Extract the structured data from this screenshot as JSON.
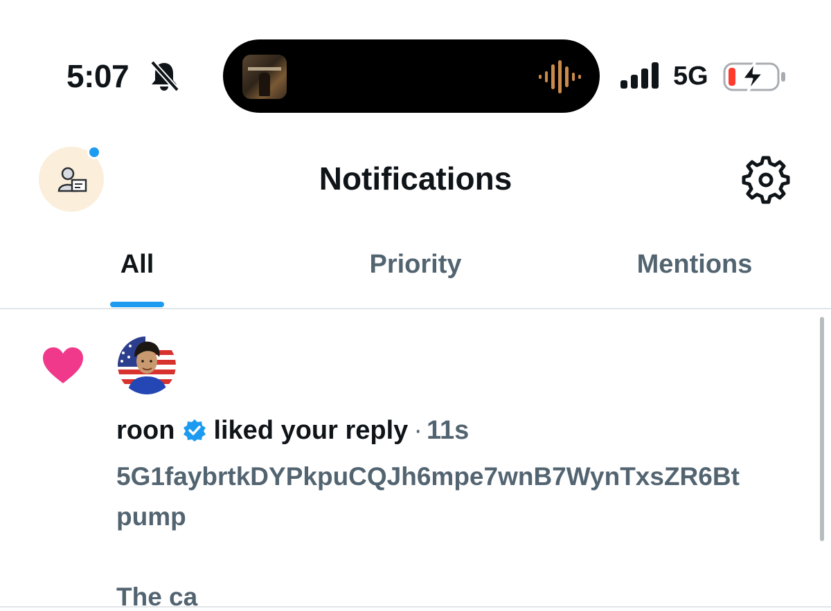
{
  "status_bar": {
    "time": "5:07",
    "network": "5G",
    "icons": [
      "bell-slash-icon",
      "signal-bars-icon",
      "battery-charging-icon"
    ],
    "battery_color": "#ff3b30"
  },
  "dynamic_island": {
    "icons": [
      "album-art",
      "waveform-icon"
    ],
    "waveform_color": "#c98a4b"
  },
  "header": {
    "title": "Notifications",
    "icons": [
      "profile-avatar",
      "gear-icon"
    ],
    "unread_dot_color": "#1d9bf0"
  },
  "tabs": [
    {
      "label": "All",
      "active": true
    },
    {
      "label": "Priority",
      "active": false
    },
    {
      "label": "Mentions",
      "active": false
    }
  ],
  "notification": {
    "type_icon": "heart-icon",
    "heart_color": "#f0398a",
    "actor": "roon",
    "verified_icon": "verified-badge-icon",
    "action": "liked your reply",
    "separator": "·",
    "time": "11s",
    "body": {
      "line1": "5G1faybrtkDYPkpuCQJh6mpe7wnB7WynTxsZR6Bt",
      "line2": "pump",
      "line3": "The ca"
    }
  },
  "colors": {
    "accent": "#1d9bf0",
    "text_primary": "#0f1419",
    "text_secondary": "#536471",
    "divider": "#e1e5e8"
  }
}
